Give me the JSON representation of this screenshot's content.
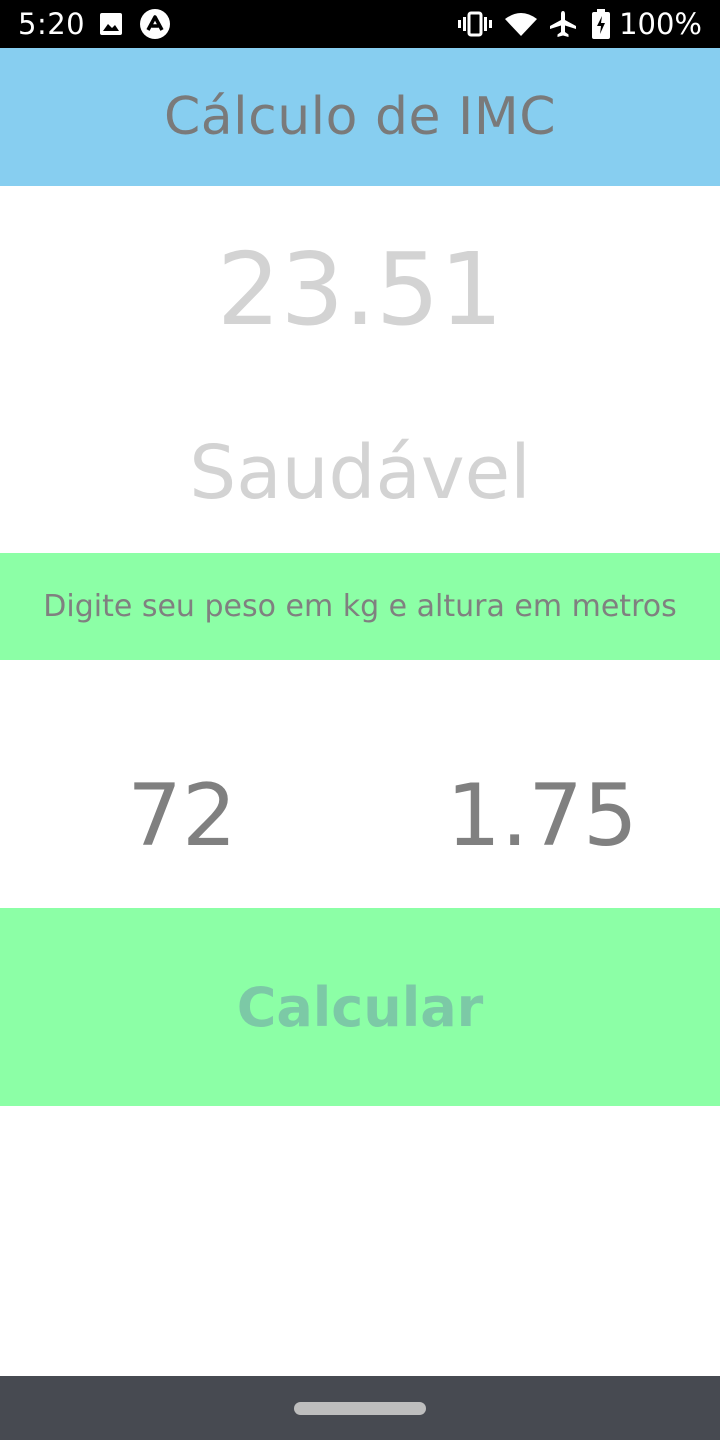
{
  "status_bar": {
    "time": "5:20",
    "battery_text": "100%",
    "icons": [
      "image-icon",
      "app-logo-icon",
      "vibrate-icon",
      "wifi-icon",
      "airplane-mode-icon",
      "battery-icon"
    ]
  },
  "header": {
    "title": "Cálculo de IMC",
    "background_color": "#87cef0"
  },
  "result": {
    "value": "23.51",
    "category": "Saudável"
  },
  "instruction": {
    "text": "Digite seu peso em kg e altura em metros",
    "background_color": "#8cffa6"
  },
  "inputs": {
    "weight_value": "72",
    "height_value": "1.75"
  },
  "button": {
    "label": "Calcular",
    "background_color": "#8cffa6"
  },
  "nav_bar": {
    "icons": [
      "home-gesture-pill"
    ]
  }
}
